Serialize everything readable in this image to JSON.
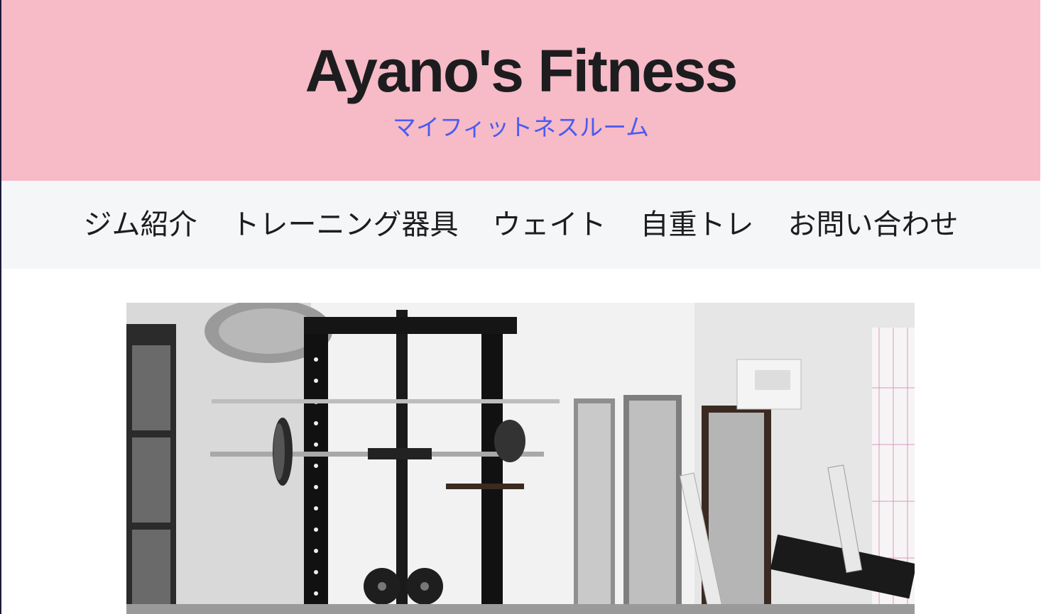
{
  "header": {
    "title": "Ayano's Fitness",
    "subtitle": "マイフィットネスルーム",
    "background_color": "#f7bac7"
  },
  "nav": {
    "items": [
      {
        "label": "ジム紹介"
      },
      {
        "label": "トレーニング器具"
      },
      {
        "label": "ウェイト"
      },
      {
        "label": "自重トレ"
      },
      {
        "label": "お問い合わせ"
      }
    ]
  },
  "hero": {
    "image_icon": "gym-photo"
  }
}
